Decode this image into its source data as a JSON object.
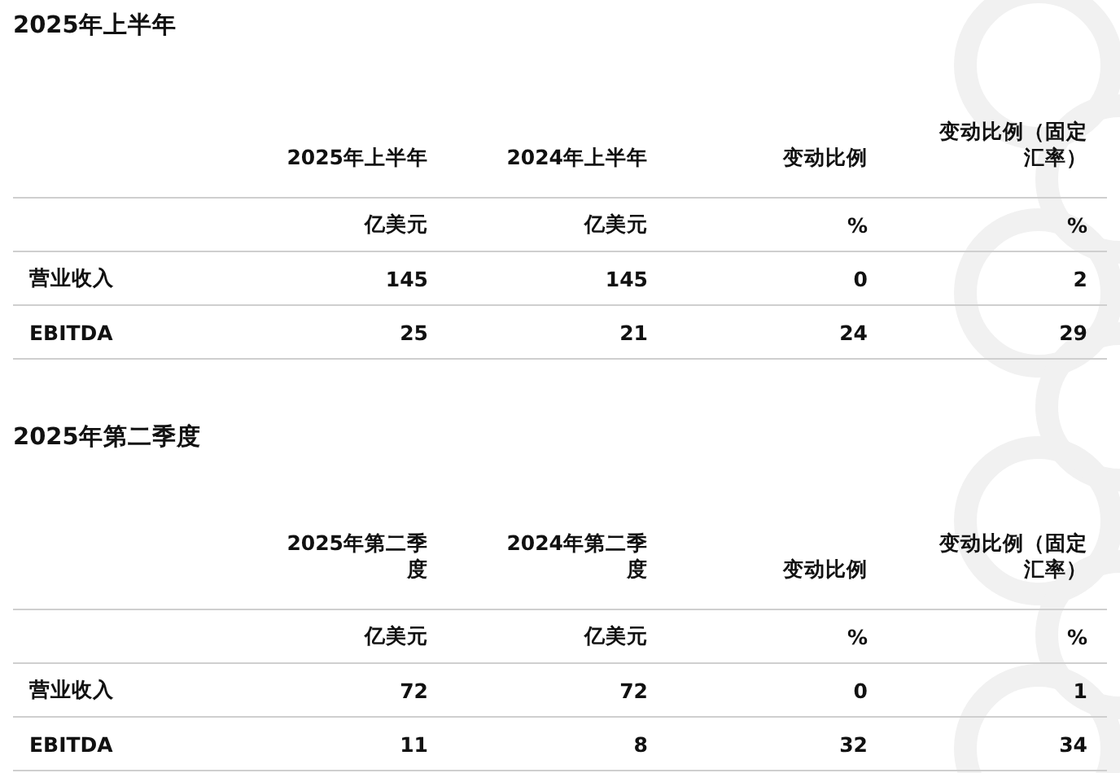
{
  "sections": [
    {
      "title": "2025年上半年",
      "columns": [
        "",
        "2025年上半年",
        "2024年上半年",
        "变动比例",
        "变动比例（固定汇率）"
      ],
      "rows": [
        [
          "",
          "亿美元",
          "亿美元",
          "%",
          "%"
        ],
        [
          "营业收入",
          "145",
          "145",
          "0",
          "2"
        ],
        [
          "EBITDA",
          "25",
          "21",
          "24",
          "29"
        ]
      ]
    },
    {
      "title": "2025年第二季度",
      "columns": [
        "",
        "2025年第二季度",
        "2024年第二季度",
        "变动比例",
        "变动比例（固定汇率）"
      ],
      "rows": [
        [
          "",
          "亿美元",
          "亿美元",
          "%",
          "%"
        ],
        [
          "营业收入",
          "72",
          "72",
          "0",
          "1"
        ],
        [
          "EBITDA",
          "11",
          "8",
          "32",
          "34"
        ]
      ]
    }
  ]
}
